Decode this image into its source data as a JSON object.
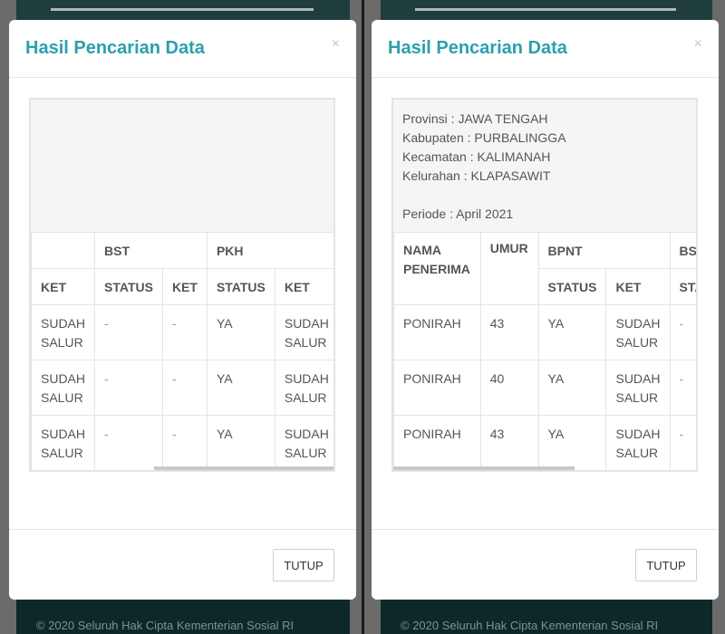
{
  "footer_text": "© 2020 Seluruh Hak Cipta Kementerian Sosial RI",
  "modal": {
    "title": "Hasil Pencarian Data",
    "close_glyph": "×",
    "close_button": "TUTUP"
  },
  "left": {
    "group_headers": [
      "",
      "BST",
      "PKH"
    ],
    "sub_headers": [
      "KET",
      "STATUS",
      "KET",
      "STATUS",
      "KET"
    ],
    "rows": [
      [
        "SUDAH SALUR",
        "-",
        "-",
        "YA",
        "SUDAH SALUR"
      ],
      [
        "SUDAH SALUR",
        "-",
        "-",
        "YA",
        "SUDAH SALUR"
      ],
      [
        "SUDAH SALUR",
        "-",
        "-",
        "YA",
        "SUDAH SALUR"
      ]
    ]
  },
  "right": {
    "info": {
      "provinsi": "Provinsi : JAWA TENGAH",
      "kabupaten": "Kabupaten : PURBALINGGA",
      "kecamatan": "Kecamatan : KALIMANAH",
      "kelurahan": "Kelurahan : KLAPASAWIT",
      "periode": "Periode : April 2021"
    },
    "headers": {
      "nama": "NAMA PENERIMA",
      "umur": "UMUR",
      "bpnt": "BPNT",
      "bst": "BST",
      "status": "STATUS",
      "ket": "KET",
      "bst_status": "STA"
    },
    "rows": [
      {
        "nama": "PONIRAH",
        "umur": "43",
        "status": "YA",
        "ket": "SUDAH SALUR",
        "bst_status": "-"
      },
      {
        "nama": "PONIRAH",
        "umur": "40",
        "status": "YA",
        "ket": "SUDAH SALUR",
        "bst_status": "-"
      },
      {
        "nama": "PONIRAH",
        "umur": "43",
        "status": "YA",
        "ket": "SUDAH SALUR",
        "bst_status": "-"
      }
    ]
  }
}
